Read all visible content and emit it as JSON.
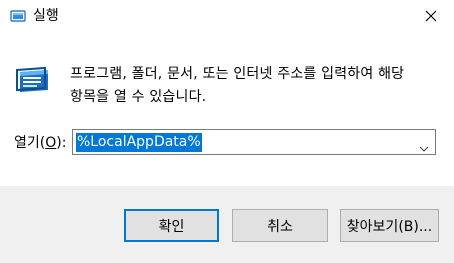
{
  "window": {
    "title": "실행",
    "close_icon": "close-icon",
    "title_icon": "run-app-icon"
  },
  "content": {
    "icon": "run-app-icon",
    "description_line1": "프로그램, 폴더, 문서, 또는 인터넷 주소를 입력하여 해당",
    "description_line2": "항목을 열 수 있습니다."
  },
  "open_field": {
    "label_prefix": "열기(",
    "label_accel": "O",
    "label_suffix": "):",
    "value": "%LocalAppData%",
    "dropdown_icon": "chevron-down-icon"
  },
  "buttons": {
    "ok": "확인",
    "cancel": "취소",
    "browse": "찾아보기(B)..."
  },
  "colors": {
    "accent": "#0078d7",
    "footer_bg": "#f0f0f0",
    "button_bg": "#e1e1e1"
  }
}
